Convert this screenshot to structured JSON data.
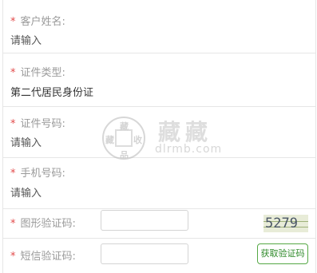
{
  "fields": {
    "name": {
      "label": "客户姓名:",
      "value": "请输入"
    },
    "id_type": {
      "label": "证件类型:",
      "value": "第二代居民身份证"
    },
    "id_number": {
      "label": "证件号码:",
      "value": "请输入"
    },
    "phone": {
      "label": "手机号码:",
      "value": "请输入"
    },
    "image_captcha": {
      "label": "图形验证码:",
      "value": "",
      "captcha_text": "5279"
    },
    "sms_code": {
      "label": "短信验证码:",
      "value": "",
      "button_label": "获取验证码"
    }
  },
  "required_mark": "*",
  "watermark": {
    "seal_chars": [
      "藏",
      "品",
      "藏",
      "收"
    ],
    "title": "藏藏",
    "url": "dlrmb.com"
  },
  "colors": {
    "required": "#e24a4a",
    "accent_green": "#55a845",
    "label": "#9a9a9a"
  }
}
